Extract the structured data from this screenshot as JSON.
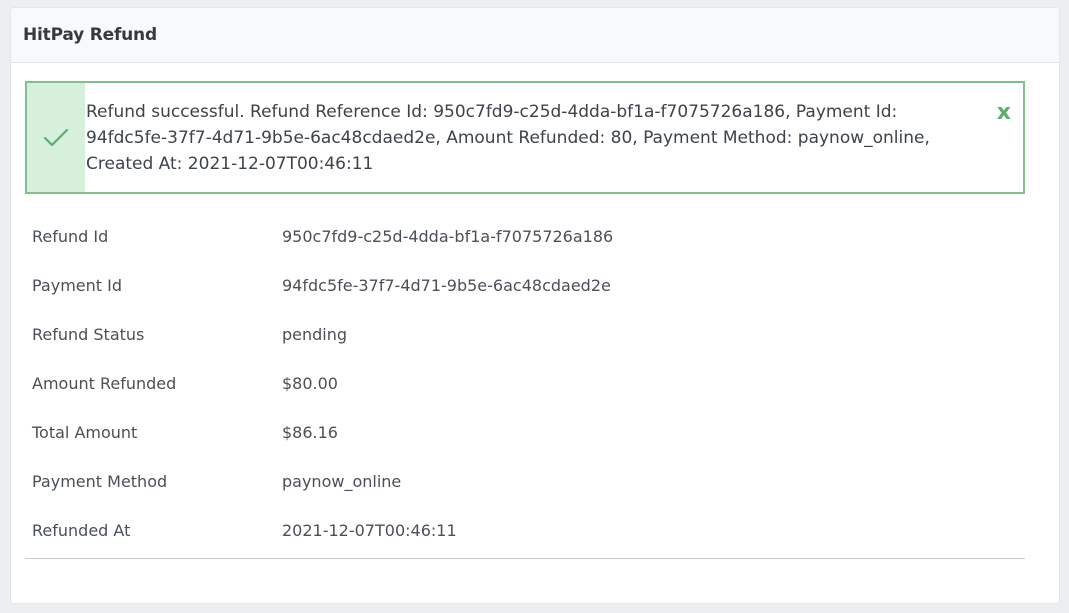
{
  "panel": {
    "title": "HitPay Refund"
  },
  "alert": {
    "icon": "checkmark-icon",
    "message": "Refund successful. Refund Reference Id: 950c7fd9-c25d-4dda-bf1a-f7075726a186, Payment Id: 94fdc5fe-37f7-4d71-9b5e-6ac48cdaed2e, Amount Refunded: 80, Payment Method: paynow_online, Created At: 2021-12-07T00:46:11",
    "close_label": "x",
    "colors": {
      "border": "#7fc08b",
      "icon_bg": "#d7f0dc",
      "accent": "#5eae6e"
    }
  },
  "details": {
    "rows": [
      {
        "label": "Refund Id",
        "value": "950c7fd9-c25d-4dda-bf1a-f7075726a186"
      },
      {
        "label": "Payment Id",
        "value": "94fdc5fe-37f7-4d71-9b5e-6ac48cdaed2e"
      },
      {
        "label": "Refund Status",
        "value": "pending"
      },
      {
        "label": "Amount Refunded",
        "value": "$80.00"
      },
      {
        "label": "Total Amount",
        "value": "$86.16"
      },
      {
        "label": "Payment Method",
        "value": "paynow_online"
      },
      {
        "label": "Refunded At",
        "value": "2021-12-07T00:46:11"
      }
    ]
  }
}
